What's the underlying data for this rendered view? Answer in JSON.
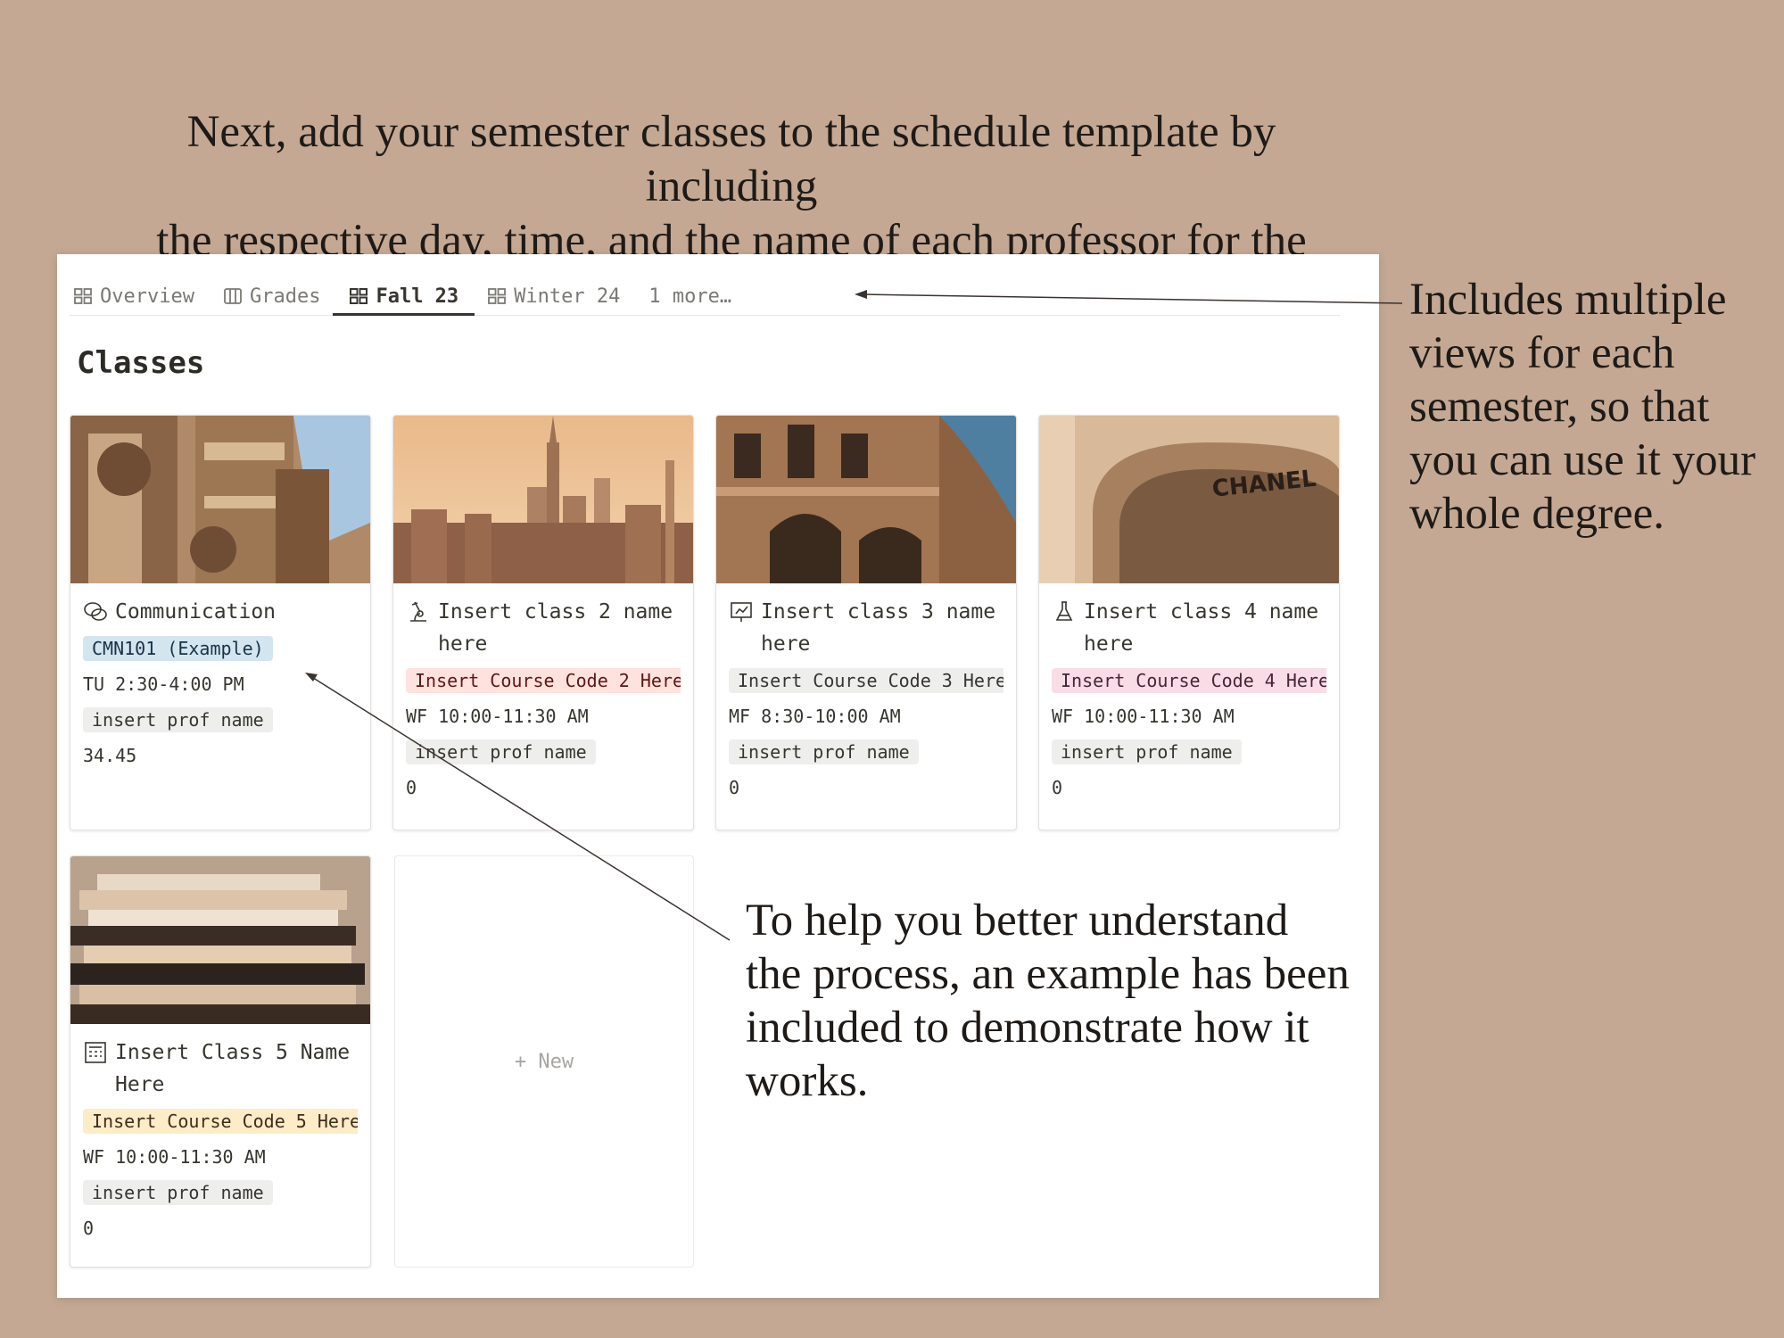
{
  "headline": {
    "line1": "Next, add your semester classes to the schedule template by including",
    "line2": "the respective day, time, and the name of each professor for the classes."
  },
  "side_note": "Includes multiple views for each semester, so that you can use it your whole degree.",
  "bottom_note": "To help you better understand the process, an example has been included to demonstrate how it works.",
  "tabs": [
    {
      "label": "Overview",
      "icon": "gallery-icon",
      "active": false
    },
    {
      "label": "Grades",
      "icon": "table-icon",
      "active": false
    },
    {
      "label": "Fall 23",
      "icon": "gallery-icon",
      "active": true
    },
    {
      "label": "Winter 24",
      "icon": "gallery-icon",
      "active": false
    },
    {
      "label": "1 more…",
      "icon": "",
      "active": false
    }
  ],
  "section_title": "Classes",
  "cards": [
    {
      "title": "Communication",
      "icon": "chat-bubbles-icon",
      "code": "CMN101 (Example)",
      "code_color": "#d3e5ef",
      "code_text": "#183347",
      "schedule": "TU 2:30-4:00 PM",
      "prof": "insert prof name",
      "grade": "34.45"
    },
    {
      "title": "Insert class 2 name here",
      "icon": "microscope-icon",
      "code": "Insert Course Code 2 Here",
      "code_color": "#ffe2dd",
      "code_text": "#5d1715",
      "schedule": "WF 10:00-11:30 AM",
      "prof": "insert prof name",
      "grade": "0"
    },
    {
      "title": "Insert class 3 name here",
      "icon": "presentation-icon",
      "code": "Insert Course Code 3 Here",
      "code_color": "#eeeeec",
      "code_text": "#37352f",
      "schedule": "MF 8:30-10:00 AM",
      "prof": "insert prof name",
      "grade": "0"
    },
    {
      "title": "Insert class 4 name here",
      "icon": "lab-flask-icon",
      "code": "Insert Course Code 4 Here",
      "code_color": "#f9dde6",
      "code_text": "#4c2337",
      "schedule": "WF 10:00-11:30 AM",
      "prof": "insert prof name",
      "grade": "0"
    },
    {
      "title": "Insert Class 5 Name Here",
      "icon": "calculator-board-icon",
      "code": "Insert Course Code 5 Here",
      "code_color": "#fdecc8",
      "code_text": "#402c1b",
      "schedule": "WF 10:00-11:30 AM",
      "prof": "insert prof name",
      "grade": "0"
    }
  ],
  "new_button": "+ New",
  "brand_sign": "CHANEL"
}
